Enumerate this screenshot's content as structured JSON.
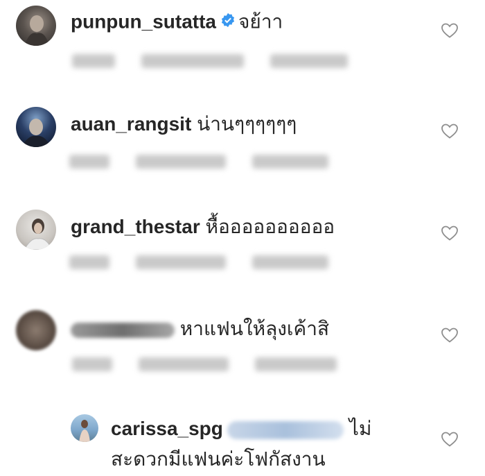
{
  "comments": [
    {
      "username": "punpun_sutatta",
      "verified": true,
      "text": "จย้าา",
      "liked": false
    },
    {
      "username": "auan_rangsit",
      "verified": false,
      "text": "น่านๆๆๆๆๆๆ",
      "liked": false
    },
    {
      "username": "grand_thestar",
      "verified": false,
      "text": "หื้ออออออออออ",
      "liked": false
    },
    {
      "username": "",
      "username_obscured": true,
      "verified": false,
      "text": "หาแฟนให้ลุงเค้าสิ",
      "liked": false
    }
  ],
  "reply": {
    "username": "carissa_spg",
    "mention_obscured": true,
    "text_line1": "ไม่",
    "text_line2": "สะดวกมีแฟนค่ะโฟกัสงาน",
    "liked": false
  },
  "colors": {
    "text": "#262626",
    "verified_badge": "#3897f0",
    "heart_outline": "#8e8e8e",
    "meta_placeholder": "#c9c9c9"
  },
  "icons": {
    "like": "heart-outline-icon",
    "verified": "verified-badge-icon"
  }
}
